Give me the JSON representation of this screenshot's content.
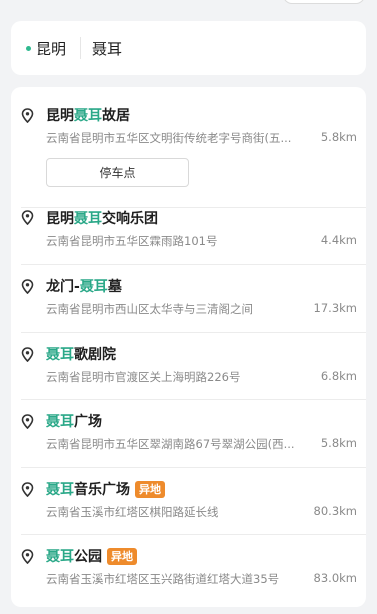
{
  "search": {
    "city": "昆明",
    "keyword": "聂耳"
  },
  "highlight_color": "#2aa888",
  "badge_color": "#ee8b2c",
  "results": [
    {
      "name_prefix": "昆明",
      "name_highlight": "聂耳",
      "name_suffix": "故居",
      "badge": "",
      "address": "云南省昆明市五华区文明街传统老字号商街(五...",
      "distance": "5.8km",
      "action_button": "停车点"
    },
    {
      "name_prefix": "昆明",
      "name_highlight": "聂耳",
      "name_suffix": "交响乐团",
      "badge": "",
      "address": "云南省昆明市五华区霖雨路101号",
      "distance": "4.4km"
    },
    {
      "name_prefix": "龙门-",
      "name_highlight": "聂耳",
      "name_suffix": "墓",
      "badge": "",
      "address": "云南省昆明市西山区太华寺与三清阁之间",
      "distance": "17.3km"
    },
    {
      "name_prefix": "",
      "name_highlight": "聂耳",
      "name_suffix": "歌剧院",
      "badge": "",
      "address": "云南省昆明市官渡区关上海明路226号",
      "distance": "6.8km"
    },
    {
      "name_prefix": "",
      "name_highlight": "聂耳",
      "name_suffix": "广场",
      "badge": "",
      "address": "云南省昆明市五华区翠湖南路67号翠湖公园(西...",
      "distance": "5.8km"
    },
    {
      "name_prefix": "",
      "name_highlight": "聂耳",
      "name_suffix": "音乐广场",
      "badge": "异地",
      "address": "云南省玉溪市红塔区棋阳路延长线",
      "distance": "80.3km"
    },
    {
      "name_prefix": "",
      "name_highlight": "聂耳",
      "name_suffix": "公园",
      "badge": "异地",
      "address": "云南省玉溪市红塔区玉兴路街道红塔大道35号",
      "distance": "83.0km"
    }
  ]
}
